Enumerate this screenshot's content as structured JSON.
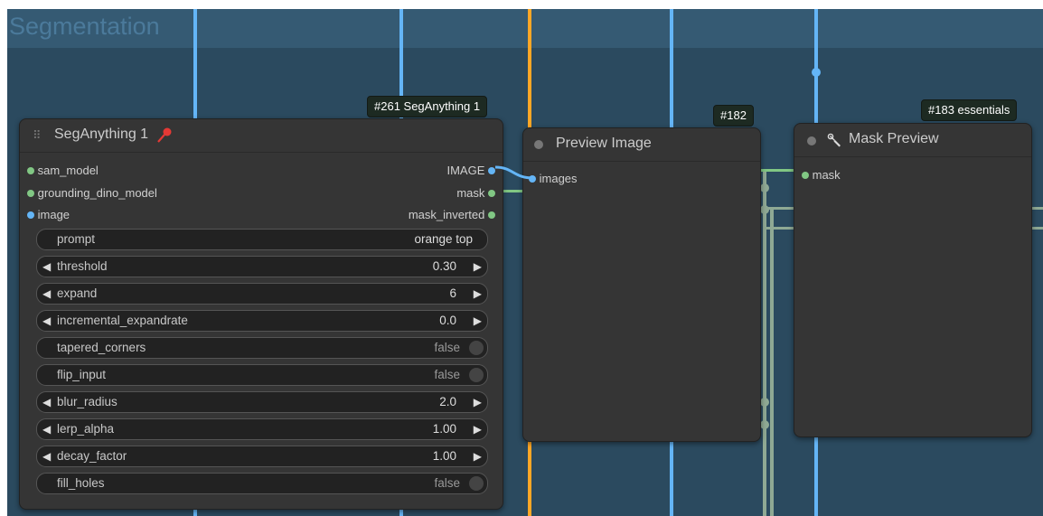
{
  "group": {
    "title": "Segmentation"
  },
  "colors": {
    "image_link": "#64b5f6",
    "mask_link": "#81c784",
    "model_link": "#ffa726",
    "reroute": "#8fa994"
  },
  "seg_node": {
    "badge": "#261 SegAnything 1",
    "title": "SegAnything 1",
    "pin_icon": "pin-icon",
    "inputs": [
      {
        "label": "sam_model",
        "color": "#81c784"
      },
      {
        "label": "grounding_dino_model",
        "color": "#81c784"
      },
      {
        "label": "image",
        "color": "#64b5f6"
      }
    ],
    "outputs": [
      {
        "label": "IMAGE",
        "color": "#64b5f6"
      },
      {
        "label": "mask",
        "color": "#81c784"
      },
      {
        "label": "mask_inverted",
        "color": "#81c784"
      }
    ],
    "widgets": [
      {
        "label": "prompt",
        "value": "orange top",
        "kind": "text"
      },
      {
        "label": "threshold",
        "value": "0.30",
        "kind": "number"
      },
      {
        "label": "expand",
        "value": "6",
        "kind": "number"
      },
      {
        "label": "incremental_expandrate",
        "value": "0.0",
        "kind": "number"
      },
      {
        "label": "tapered_corners",
        "value": "false",
        "kind": "toggle"
      },
      {
        "label": "flip_input",
        "value": "false",
        "kind": "toggle"
      },
      {
        "label": "blur_radius",
        "value": "2.0",
        "kind": "number"
      },
      {
        "label": "lerp_alpha",
        "value": "1.00",
        "kind": "number"
      },
      {
        "label": "decay_factor",
        "value": "1.00",
        "kind": "number"
      },
      {
        "label": "fill_holes",
        "value": "false",
        "kind": "toggle"
      }
    ]
  },
  "preview_node": {
    "badge": "#182",
    "title": "Preview Image",
    "inputs": [
      {
        "label": "images",
        "color": "#64b5f6"
      }
    ]
  },
  "mask_node": {
    "badge": "#183 essentials",
    "title": "Mask Preview",
    "title_icon": "wrench-icon",
    "inputs": [
      {
        "label": "mask",
        "color": "#81c784"
      }
    ]
  }
}
